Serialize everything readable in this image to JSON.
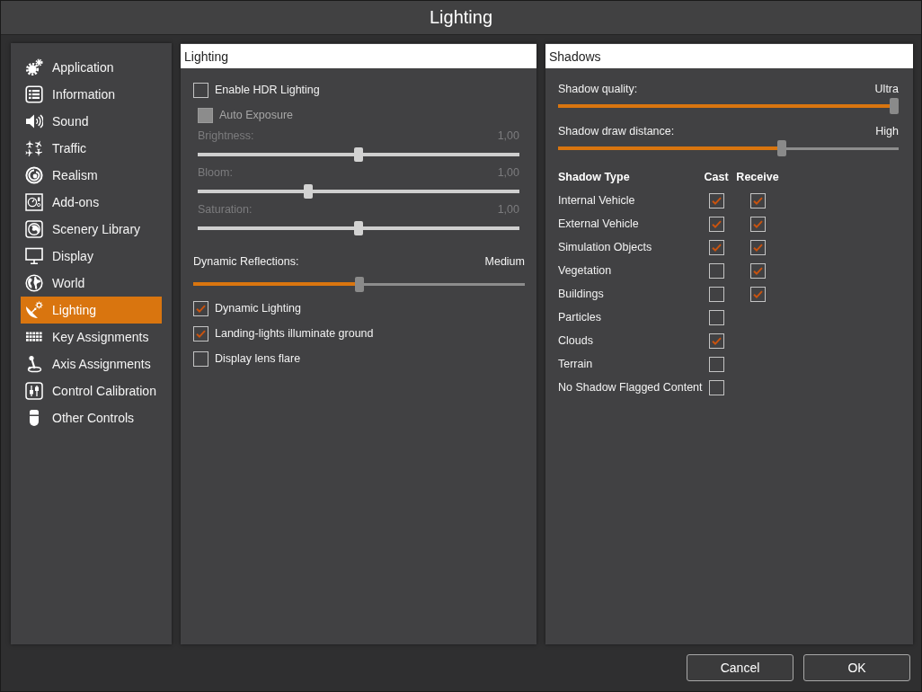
{
  "window": {
    "title": "Lighting"
  },
  "sidebar": {
    "items": [
      {
        "label": "Application",
        "selected": false
      },
      {
        "label": "Information",
        "selected": false
      },
      {
        "label": "Sound",
        "selected": false
      },
      {
        "label": "Traffic",
        "selected": false
      },
      {
        "label": "Realism",
        "selected": false
      },
      {
        "label": "Add-ons",
        "selected": false
      },
      {
        "label": "Scenery Library",
        "selected": false
      },
      {
        "label": "Display",
        "selected": false
      },
      {
        "label": "World",
        "selected": false
      },
      {
        "label": "Lighting",
        "selected": true
      },
      {
        "label": "Key Assignments",
        "selected": false
      },
      {
        "label": "Axis Assignments",
        "selected": false
      },
      {
        "label": "Control Calibration",
        "selected": false
      },
      {
        "label": "Other Controls",
        "selected": false
      }
    ]
  },
  "lighting_panel": {
    "title": "Lighting",
    "controls": [
      {
        "kind": "checkbox",
        "label": "Enable HDR Lighting",
        "checked": false,
        "disabled": false,
        "children": [
          {
            "kind": "checkbox",
            "label": "Auto Exposure",
            "checked": false,
            "disabled": true
          },
          {
            "kind": "slider",
            "label": "Brightness:",
            "reading": "1,00",
            "level": 0.5,
            "disabled": true
          },
          {
            "kind": "slider",
            "label": "Bloom:",
            "reading": "1,00",
            "level": 0.34,
            "disabled": true
          },
          {
            "kind": "slider",
            "label": "Saturation:",
            "reading": "1,00",
            "level": 0.5,
            "disabled": true
          }
        ]
      },
      {
        "kind": "slider",
        "label": "Dynamic Reflections:",
        "reading": "Medium",
        "level": 0.5,
        "disabled": false
      },
      {
        "kind": "checkbox",
        "label": "Dynamic Lighting",
        "checked": true,
        "disabled": false
      },
      {
        "kind": "checkbox",
        "label": "Landing-lights illuminate ground",
        "checked": true,
        "disabled": false
      },
      {
        "kind": "checkbox",
        "label": "Display lens flare",
        "checked": false,
        "disabled": false
      }
    ]
  },
  "shadows_panel": {
    "title": "Shadows",
    "sliders": [
      {
        "label": "Shadow quality:",
        "reading": "Ultra",
        "level": 1.0
      },
      {
        "label": "Shadow draw distance:",
        "reading": "High",
        "level": 0.66
      }
    ],
    "table": {
      "columns": [
        "Shadow Type",
        "Cast",
        "Receive"
      ],
      "rows": [
        {
          "name": "Internal Vehicle",
          "cast": true,
          "receive": true
        },
        {
          "name": "External Vehicle",
          "cast": true,
          "receive": true
        },
        {
          "name": "Simulation Objects",
          "cast": true,
          "receive": true
        },
        {
          "name": "Vegetation",
          "cast": false,
          "receive": true
        },
        {
          "name": "Buildings",
          "cast": false,
          "receive": true
        },
        {
          "name": "Particles",
          "cast": false
        },
        {
          "name": "Clouds",
          "cast": true
        },
        {
          "name": "Terrain",
          "cast": false
        },
        {
          "name": "No Shadow Flagged Content",
          "cast": false
        }
      ]
    }
  },
  "buttons": [
    {
      "label": "Cancel"
    },
    {
      "label": "OK"
    }
  ]
}
